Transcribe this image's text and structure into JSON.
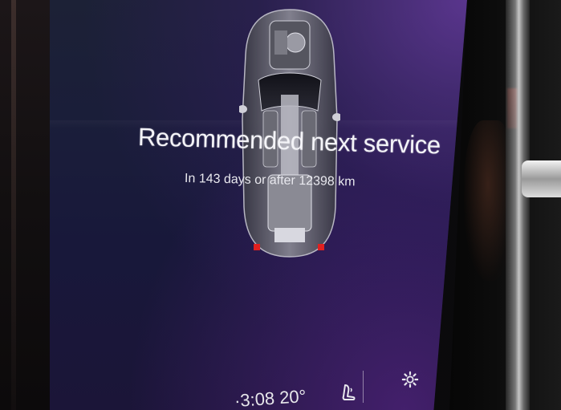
{
  "service": {
    "title": "Recommended next service",
    "subtitle": "In 143 days or after 12398 km"
  },
  "status_bar": {
    "time_and_temp": "·3:08  20°",
    "seat_icon": "seat-heating-icon",
    "settings_icon": "gear-icon"
  },
  "colors": {
    "screen_bg": "#1a1d3a",
    "accent_purple": "#6e3caa",
    "text": "#f4f4f8"
  }
}
